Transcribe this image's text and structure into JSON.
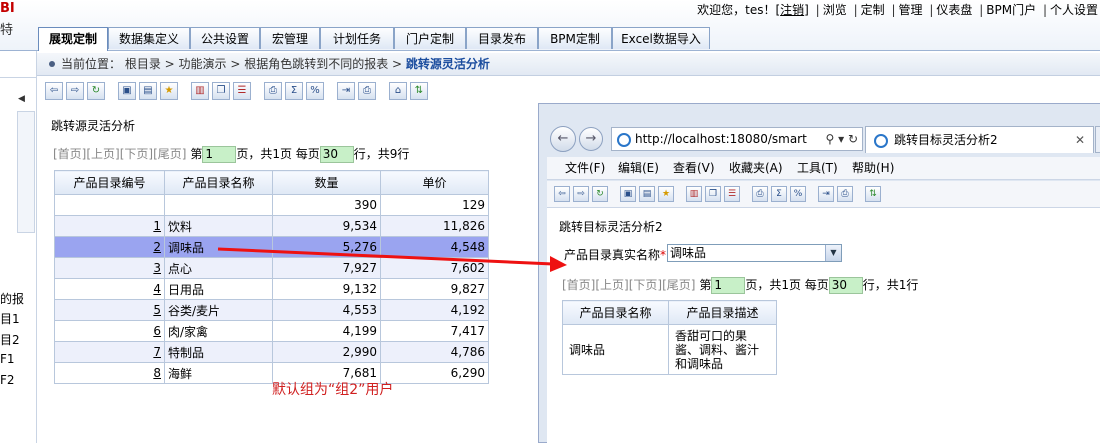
{
  "header": {
    "logo_text": "BI",
    "logo_sub": "特",
    "welcome": "欢迎您，tes！[",
    "logout": "注销",
    "welcome_end": "]",
    "links": [
      "浏览",
      "定制",
      "管理",
      "仪表盘",
      "BPM门户",
      "个人设置"
    ]
  },
  "tabs": [
    "展现定制",
    "数据集定义",
    "公共设置",
    "宏管理",
    "计划任务",
    "门户定制",
    "目录发布",
    "BPM定制",
    "Excel数据导入"
  ],
  "left_strip": [
    "的报",
    "目1",
    "目2",
    "F1",
    "F2"
  ],
  "breadcrumb": {
    "label": "当前位置：",
    "path": "根目录 > 功能演示 > 根据角色跳转到不同的报表 >",
    "current": "跳转源灵活分析"
  },
  "report": {
    "title": "跳转源灵活分析",
    "pager": {
      "first": "[首页]",
      "prev": "[上页]",
      "next": "[下页]",
      "last": "[尾页]",
      "page_prefix": "第",
      "page": "1",
      "page_suffix": "页，共1页 每页",
      "per_page": "30",
      "rows_suffix": "行，共9行"
    },
    "columns": [
      "产品目录编号",
      "产品目录名称",
      "数量",
      "单价"
    ],
    "summary_row": [
      "",
      "",
      "390",
      "129"
    ],
    "rows": [
      [
        "1",
        "饮料",
        "9,534",
        "11,826"
      ],
      [
        "2",
        "调味品",
        "5,276",
        "4,548"
      ],
      [
        "3",
        "点心",
        "7,927",
        "7,602"
      ],
      [
        "4",
        "日用品",
        "9,132",
        "9,827"
      ],
      [
        "5",
        "谷类/麦片",
        "4,553",
        "4,192"
      ],
      [
        "6",
        "肉/家禽",
        "4,199",
        "7,417"
      ],
      [
        "7",
        "特制品",
        "2,990",
        "4,786"
      ],
      [
        "8",
        "海鲜",
        "7,681",
        "6,290"
      ]
    ],
    "selected_row": 1
  },
  "note": "默认组为“组2”用户",
  "popup": {
    "url": "http://localhost:18080/smart",
    "tab_title": "跳转目标灵活分析2",
    "menu": [
      "文件(F)",
      "编辑(E)",
      "查看(V)",
      "收藏夹(A)",
      "工具(T)",
      "帮助(H)"
    ],
    "title": "跳转目标灵活分析2",
    "param_label": "产品目录真实名称",
    "param_required": "*",
    "param_value": "调味品",
    "pager": {
      "first": "[首页]",
      "prev": "[上页]",
      "next": "[下页]",
      "last": "[尾页]",
      "page_prefix": "第",
      "page": "1",
      "page_suffix": "页，共1页 每页",
      "per_page": "30",
      "rows_suffix": "行，共1行"
    },
    "columns": [
      "产品目录名称",
      "产品目录描述"
    ],
    "rows": [
      [
        "调味品",
        "香甜可口的果酱、调料、酱汁和调味品"
      ]
    ]
  }
}
